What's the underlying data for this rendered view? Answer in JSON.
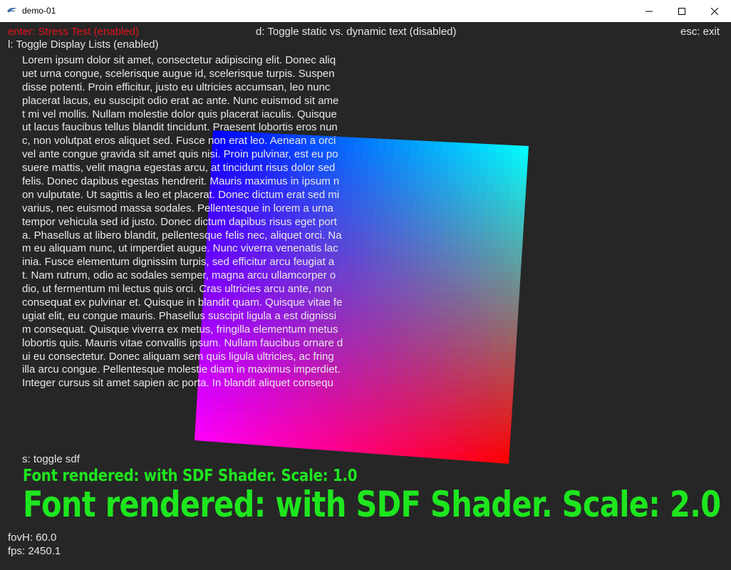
{
  "window": {
    "title": "demo-01",
    "app_icon": "app-icon",
    "controls": {
      "minimize": "minimize-icon",
      "maximize": "maximize-icon",
      "close": "close-icon"
    }
  },
  "hud": {
    "enter_label": "enter: Stress Test (enabled)",
    "d_label": "d: Toggle static vs. dynamic text (disabled)",
    "esc_label": "esc: exit",
    "l_label": "l: Toggle Display Lists (enabled)",
    "s_label": "s: toggle sdf",
    "sdf_small": "Font rendered: with SDF Shader. Scale: 1.0",
    "sdf_large": "Font rendered: with SDF Shader. Scale: 2.0",
    "fov": "fovH: 60.0",
    "fps": "fps: 2450.1"
  },
  "colors": {
    "background": "#262626",
    "hud_text": "#e6e6e6",
    "enter_text": "#e0141e",
    "sdf_text": "#1ee61e",
    "quad_corners": {
      "top_left": "#0000ff",
      "top_right": "#00ffff",
      "bottom_left": "#ff00ff",
      "bottom_right": "#ff0000"
    }
  },
  "lorem_lines": [
    "Lorem ipsum dolor sit amet, consectetur adipiscing elit. Donec aliq",
    "uet urna congue, scelerisque augue id, scelerisque turpis. Suspen",
    "disse potenti. Proin efficitur, justo eu ultricies accumsan, leo nunc",
    "placerat lacus, eu suscipit odio erat ac ante. Nunc euismod sit ame",
    "t mi vel mollis. Nullam molestie dolor quis placerat iaculis. Quisque",
    "ut lacus faucibus tellus blandit tincidunt. Praesent lobortis eros nun",
    "c, non volutpat eros aliquet sed. Fusce non erat leo. Aenean a orci",
    "vel ante congue gravida sit amet quis nisi. Proin pulvinar, est eu po",
    "suere mattis, velit magna egestas arcu, at tincidunt risus dolor sed",
    "felis. Donec dapibus egestas hendrerit. Mauris maximus in ipsum n",
    "on vulputate. Ut sagittis a leo et placerat. Donec dictum erat sed mi",
    "varius, nec euismod massa sodales. Pellentesque in lorem a urna",
    "tempor vehicula sed id justo. Donec dictum dapibus risus eget port",
    "a. Phasellus at libero blandit, pellentesque felis nec, aliquet orci. Na",
    "m eu aliquam nunc, ut imperdiet augue. Nunc viverra venenatis lac",
    "inia. Fusce elementum dignissim turpis, sed efficitur arcu feugiat a",
    "t. Nam rutrum, odio ac sodales semper, magna arcu ullamcorper o",
    "dio, ut fermentum mi lectus quis orci. Cras ultricies arcu ante, non",
    "consequat ex pulvinar et. Quisque in blandit quam. Quisque vitae fe",
    "ugiat elit, eu congue mauris. Phasellus suscipit ligula a est dignissi",
    "m consequat. Quisque viverra ex metus, fringilla elementum metus",
    "lobortis quis. Mauris vitae convallis ipsum. Nullam faucibus ornare d",
    "ui eu consectetur. Donec aliquam sem quis ligula ultricies, ac fring",
    "illa arcu congue. Pellentesque molestie diam in maximus imperdiet.",
    "Integer cursus sit amet sapien ac porta. In blandit aliquet consequ"
  ]
}
